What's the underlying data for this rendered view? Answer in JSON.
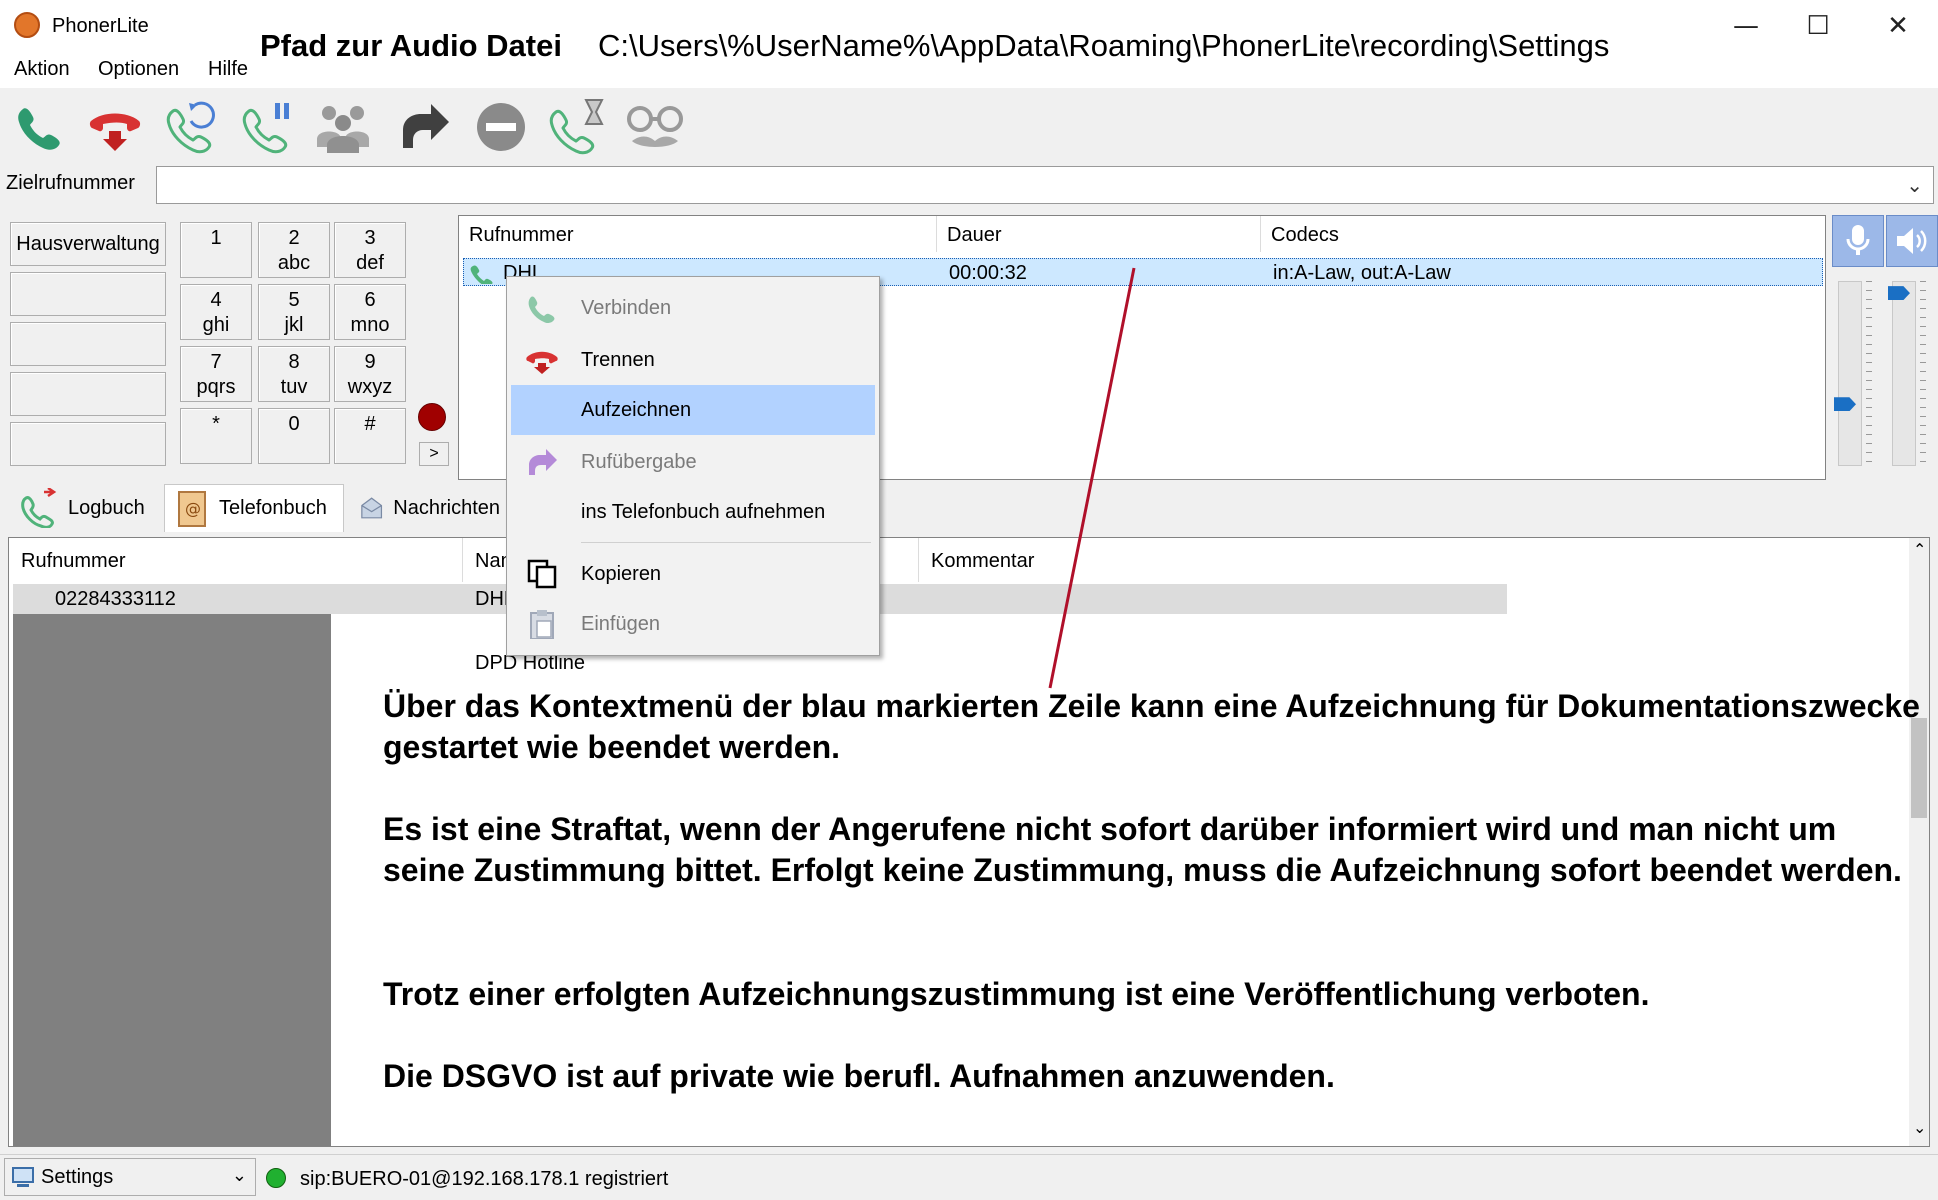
{
  "window": {
    "title": "PhonerLite",
    "minimize": "—",
    "maximize": "☐",
    "close": "✕"
  },
  "menu": [
    {
      "label": "Aktion"
    },
    {
      "label": "Optionen"
    },
    {
      "label": "Hilfe"
    }
  ],
  "annotation_path": {
    "label": "Pfad zur Audio Datei",
    "path": "C:\\Users\\%UserName%\\AppData\\Roaming\\PhonerLite\\recording\\Settings"
  },
  "toolbar": {
    "icons": [
      "dial-icon",
      "hangup-icon",
      "callback-icon",
      "hold-icon",
      "conference-icon",
      "transfer-icon",
      "dnd-icon",
      "callwaiting-icon",
      "anonymous-icon"
    ]
  },
  "target": {
    "label": "Zielrufnummer",
    "value": ""
  },
  "speed_dial": [
    {
      "label": "Hausverwaltung"
    },
    {
      "label": ""
    },
    {
      "label": ""
    },
    {
      "label": ""
    },
    {
      "label": ""
    }
  ],
  "keypad": [
    {
      "digit": "1",
      "letters": ""
    },
    {
      "digit": "2",
      "letters": "abc"
    },
    {
      "digit": "3",
      "letters": "def"
    },
    {
      "digit": "4",
      "letters": "ghi"
    },
    {
      "digit": "5",
      "letters": "jkl"
    },
    {
      "digit": "6",
      "letters": "mno"
    },
    {
      "digit": "7",
      "letters": "pqrs"
    },
    {
      "digit": "8",
      "letters": "tuv"
    },
    {
      "digit": "9",
      "letters": "wxyz"
    },
    {
      "digit": "*",
      "letters": ""
    },
    {
      "digit": "0",
      "letters": ""
    },
    {
      "digit": "#",
      "letters": ""
    }
  ],
  "more_label": ">",
  "calls": {
    "columns": [
      "Rufnummer",
      "Dauer",
      "Codecs"
    ],
    "rows": [
      {
        "number": "DHL",
        "duration": "00:00:32",
        "codecs": "in:A-Law, out:A-Law"
      }
    ]
  },
  "volume": {
    "mic_level": 0.32,
    "speaker_level": 0.97
  },
  "tabs": [
    {
      "label": "Logbuch"
    },
    {
      "label": "Telefonbuch"
    },
    {
      "label": "Nachrichten"
    }
  ],
  "phonebook": {
    "columns": [
      "Rufnummer",
      "Name",
      "Kommentar"
    ],
    "rows": [
      {
        "number": "02284333112",
        "name": "DHL"
      },
      {
        "number": "",
        "name": "DPD Hotline"
      }
    ]
  },
  "context_menu": [
    {
      "label": "Verbinden",
      "disabled": true,
      "icon": "phone-icon"
    },
    {
      "label": "Trennen",
      "disabled": false,
      "icon": "hangup-icon"
    },
    {
      "label": "Aufzeichnen",
      "disabled": false,
      "highlighted": true,
      "icon": ""
    },
    {
      "label": "Rufübergabe",
      "disabled": true,
      "icon": "transfer-icon"
    },
    {
      "label": "ins Telefonbuch aufnehmen",
      "disabled": false,
      "icon": ""
    },
    {
      "label": "Kopieren",
      "disabled": false,
      "icon": "copy-icon"
    },
    {
      "label": "Einfügen",
      "disabled": true,
      "icon": "paste-icon"
    }
  ],
  "note": {
    "p1": "Über das Kontextmenü der blau markierten Zeile kann eine Aufzeichnung für Dokumentationszwecke gestartet wie beendet werden.",
    "p2": "Es ist eine Straftat, wenn der Angerufene nicht sofort darüber informiert wird und man nicht um seine Zustimmung bittet. Erfolgt keine Zustimmung, muss die Aufzeichnung sofort beendet werden.",
    "p3": "Trotz einer erfolgten Aufzeichnungszustimmung ist eine Veröffentlichung verboten.",
    "p4": "Die DSGVO ist auf private wie berufl. Aufnahmen anzuwenden."
  },
  "status": {
    "profile": "Settings",
    "text": "sip:BUERO-01@192.168.178.1 registriert"
  },
  "colors": {
    "accent": "#1a6fc4",
    "selection": "#cde8ff",
    "highlight": "#b2d2ff",
    "arrow": "#b0102a",
    "status_ok": "#20b030"
  }
}
